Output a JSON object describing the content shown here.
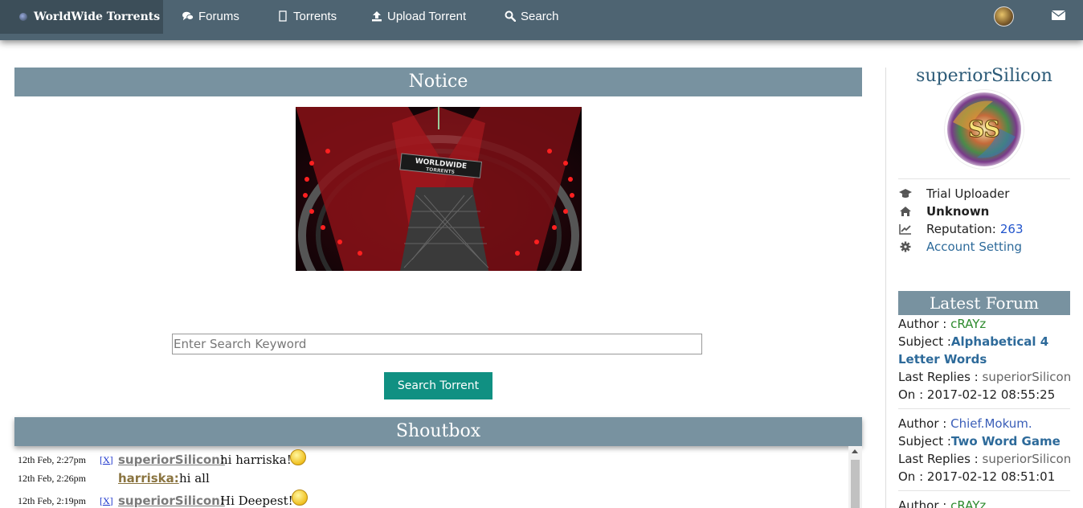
{
  "nav": {
    "brand": "WorldWide Torrents",
    "items": [
      {
        "label": "Forums",
        "icon": "comments-icon"
      },
      {
        "label": "Torrents",
        "icon": "file-icon"
      },
      {
        "label": "Upload Torrent",
        "icon": "upload-icon"
      },
      {
        "label": "Search",
        "icon": "search-icon"
      }
    ],
    "mail_icon": "envelope-icon"
  },
  "notice": {
    "title": "Notice",
    "banner_logo_line1": "WORLDWIDE",
    "banner_logo_line2": "TORRENTS"
  },
  "search": {
    "placeholder": "Enter Search Keyword",
    "button_label": "Search Torrent"
  },
  "shoutbox": {
    "title": "Shoutbox",
    "delete_label": "[X]",
    "messages": [
      {
        "time": "12th Feb, 2:27pm",
        "user": "superiorSilicon:",
        "text": "hi harriska!",
        "deletable": true,
        "smiley": true
      },
      {
        "time": "12th Feb, 2:26pm",
        "user": "harriska:",
        "text": "hi all",
        "deletable": false,
        "smiley": false
      },
      {
        "time": "12th Feb, 2:19pm",
        "user": "superiorSilicon:",
        "text": "Hi Deepest!",
        "deletable": true,
        "smiley": true
      }
    ]
  },
  "profile": {
    "username": "superiorSilicon",
    "rank": "Trial Uploader",
    "location": "Unknown",
    "reputation_label": "Reputation:",
    "reputation_value": "263",
    "account_setting": "Account Setting",
    "avatar_text": "SS"
  },
  "latest_forum": {
    "title": "Latest Forum",
    "labels": {
      "author": "Author :",
      "subject": "Subject :",
      "last_replies": "Last Replies :",
      "on": "On :"
    },
    "posts": [
      {
        "author": "cRAYz",
        "subject_line1": "Alphabetical 4",
        "subject_line2": "Letter Words",
        "last_replies": "superiorSilicon",
        "on": "2017-02-12 08:55:25"
      },
      {
        "author": "Chief.Mokum.",
        "subject": "Two Word Game",
        "last_replies": "superiorSilicon",
        "on": "2017-02-12 08:51:01"
      },
      {
        "author": "cRAYz"
      }
    ]
  }
}
